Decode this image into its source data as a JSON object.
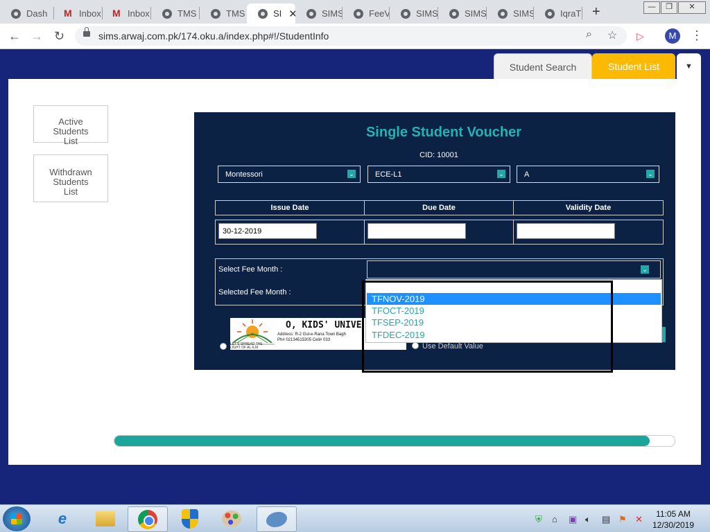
{
  "browser": {
    "tabs": [
      {
        "label": "Dash",
        "icon": "globe-icon"
      },
      {
        "label": "Inbox",
        "icon": "gmail-icon"
      },
      {
        "label": "Inbox",
        "icon": "gmail-icon"
      },
      {
        "label": "TMS",
        "icon": "globe-icon"
      },
      {
        "label": "TMS",
        "icon": "globe-icon"
      },
      {
        "label": "SI",
        "icon": "globe-icon",
        "active": true
      },
      {
        "label": "SIMS",
        "icon": "globe-icon"
      },
      {
        "label": "FeeV",
        "icon": "globe-icon"
      },
      {
        "label": "SIMS",
        "icon": "globe-icon"
      },
      {
        "label": "SIMS",
        "icon": "globe-icon"
      },
      {
        "label": "SIMS",
        "icon": "globe-icon"
      },
      {
        "label": "IqraT",
        "icon": "globe-icon"
      }
    ],
    "url": "sims.arwaj.com.pk/174.oku.a/index.php#!/StudentInfo",
    "avatar_letter": "M"
  },
  "page_tabs": {
    "student_search": "Student Search",
    "student_list": "Student List"
  },
  "sidebar": {
    "active": "Active Students List",
    "withdrawn": "Withdrawn Students List"
  },
  "voucher": {
    "title": "Single Student Voucher",
    "cid": "CID: 10001",
    "selects": {
      "program": "Montessori",
      "class": "ECE-L1",
      "section": "A"
    },
    "table": {
      "headers": [
        "Issue Date",
        "Due Date",
        "Validity Date"
      ],
      "issue_date": "30-12-2019",
      "due_date": "",
      "validity_date": ""
    },
    "select_fee_month_label": "Select Fee Month :",
    "selected_fee_month_label": "Selected Fee Month :",
    "logo": {
      "name": "O, KIDS' UNIVE",
      "address": "Address: R-2 Gul-e-Rana Town Bagh",
      "phone": "Ph# 02134515305 Cell# 033",
      "tagline": "LET'S SPREAD THE LIGHT OF AL-ILM"
    },
    "use_default_label": "Use Default Value"
  },
  "dropdown": {
    "options": [
      "TFNOV-2019",
      "TFOCT-2019",
      "TFSEP-2019",
      "TFDEC-2019"
    ],
    "highlighted": "TFNOV-2019"
  },
  "progress": {
    "value": 0.955
  },
  "taskbar": {
    "clock_time": "11:05 AM",
    "clock_date": "12/30/2019"
  },
  "colors": {
    "brand_navy": "#16247a",
    "panel": "#0c2244",
    "teal": "#22b3b3",
    "active_tab": "#fbb900",
    "highlight": "#1e90ff"
  }
}
